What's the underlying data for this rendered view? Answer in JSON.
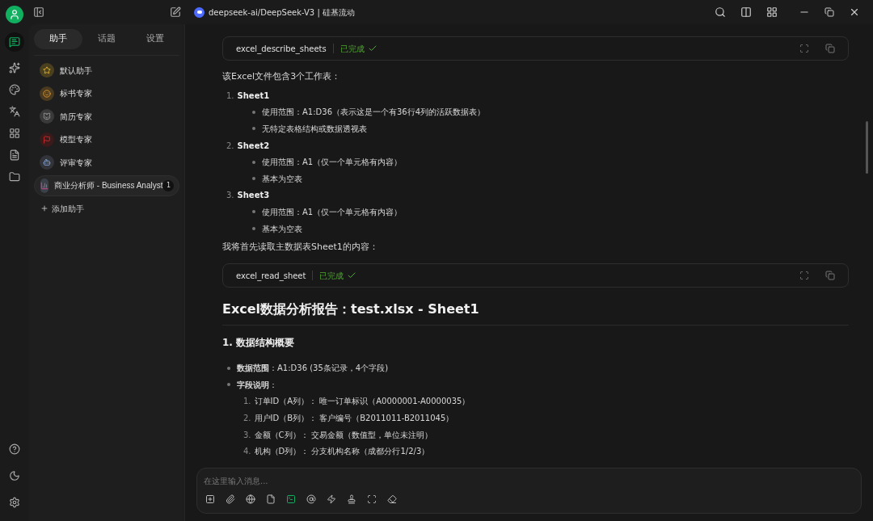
{
  "window": {
    "title": "deepseek-ai/DeepSeek-V3 | 硅基流动"
  },
  "sidebar": {
    "tabs": [
      {
        "label": "助手",
        "selected": true
      },
      {
        "label": "话题",
        "selected": false
      },
      {
        "label": "设置",
        "selected": false
      }
    ],
    "assistants": [
      {
        "name": "默认助手",
        "kind": "star",
        "selected": false
      },
      {
        "name": "标书专家",
        "kind": "face",
        "selected": false
      },
      {
        "name": "简历专家",
        "kind": "animal",
        "selected": false
      },
      {
        "name": "模型专家",
        "kind": "flag",
        "selected": false
      },
      {
        "name": "评审专家",
        "kind": "robot",
        "selected": false
      },
      {
        "name": "商业分析师 - Business Analyst",
        "kind": "chart",
        "selected": true,
        "count": "1"
      }
    ],
    "add_label": "添加助手"
  },
  "content": [
    {
      "kind": "tool",
      "name": "excel_describe_sheets",
      "status": "已完成"
    },
    {
      "kind": "para",
      "text": "该Excel文件包含3个工作表："
    },
    {
      "kind": "sheets",
      "items": [
        {
          "number": "1.",
          "title": "Sheet1",
          "bullets": [
            "使用范围：A1:D36（表示这是一个有36行4列的活跃数据表）",
            "无特定表格结构或数据透视表"
          ]
        },
        {
          "number": "2.",
          "title": "Sheet2",
          "bullets": [
            "使用范围：A1（仅一个单元格有内容）",
            "基本为空表"
          ]
        },
        {
          "number": "3.",
          "title": "Sheet3",
          "bullets": [
            "使用范围：A1（仅一个单元格有内容）",
            "基本为空表"
          ]
        }
      ]
    },
    {
      "kind": "para",
      "text": "我将首先读取主数据表Sheet1的内容："
    },
    {
      "kind": "tool",
      "name": "excel_read_sheet",
      "status": "已完成"
    },
    {
      "kind": "h1",
      "text": "Excel数据分析报告：test.xlsx - Sheet1"
    },
    {
      "kind": "h2",
      "text": "1. 数据结构概要"
    },
    {
      "kind": "bullets",
      "items": [
        {
          "text": "**数据范围**：A1:D36 (35条记录，4个字段)"
        },
        {
          "text": "**字段说明**：",
          "children": [
            {
              "number": "1.",
              "text": "订单ID（A列）： 唯一订单标识（A0000001-A0000035）"
            },
            {
              "number": "2.",
              "text": "用户ID（B列）： 客户编号（B2011011-B2011045）"
            },
            {
              "number": "3.",
              "text": "金额（C列）： 交易金额（数值型，单位未注明）"
            },
            {
              "number": "4.",
              "text": "机构（D列）： 分支机构名称（成都分行1/2/3）"
            }
          ]
        }
      ]
    }
  ],
  "composer": {
    "placeholder": "在这里输入消息...",
    "mcp_active": true
  }
}
